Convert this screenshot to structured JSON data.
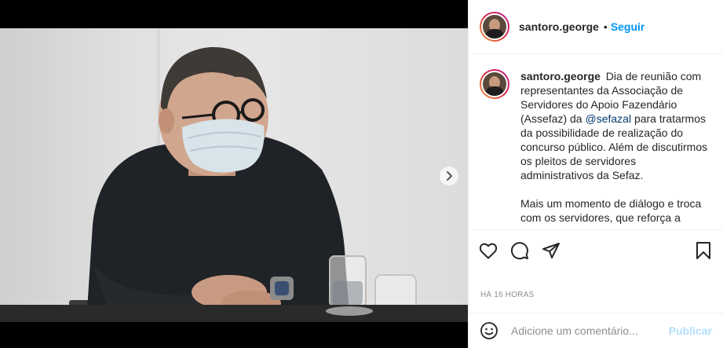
{
  "post": {
    "username": "santoro.george",
    "follow_separator": "•",
    "follow_label": "Seguir",
    "caption_user": "santoro.george",
    "caption_part1": "Dia de reunião com representantes da Associação de Servidores do Apoio Fazendário (Assefaz) da ",
    "caption_mention": "@sefazal",
    "caption_part2": " para tratarmos da possibilidade de realização do concurso público. Além de discutirmos os pleitos de servidores administrativos da Sefaz.",
    "caption_paragraph2": "Mais um momento de diálogo e troca com os servidores, que reforça a",
    "time": "HÁ 16 HORAS"
  },
  "comment": {
    "placeholder": "Adicione um comentário...",
    "publish_label": "Publicar"
  },
  "icons": {
    "like": "heart-icon",
    "comment": "comment-icon",
    "share": "paper-plane-icon",
    "save": "bookmark-icon",
    "emoji": "smiley-icon",
    "next": "chevron-right-icon"
  },
  "colors": {
    "follow": "#0095f6",
    "publish_disabled": "#b2dffc",
    "mention": "#00376b",
    "meta": "#8e8e8e"
  }
}
